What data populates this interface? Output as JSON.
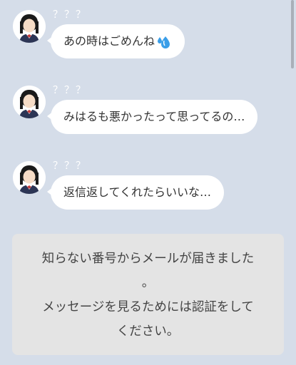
{
  "messages": [
    {
      "sender": "？？？",
      "text": "あの時はごめんね",
      "emoji": "sweat-droplets-icon"
    },
    {
      "sender": "？？？",
      "text": "みはるも悪かったって思ってるの…"
    },
    {
      "sender": "？？？",
      "text": "返信返してくれたらいいな…"
    }
  ],
  "notice": {
    "line1": "知らない番号からメールが届きました",
    "line2": "。",
    "line3": "メッセージを見るためには認証をして",
    "line4": "ください。"
  },
  "colors": {
    "background": "#d5dde9",
    "bubble": "#ffffff",
    "notice_bg": "#e4e4e4",
    "text": "#333333",
    "ribbon": "#c23a3a",
    "uniform": "#2c3555",
    "emoji": "#3a9ee8"
  }
}
